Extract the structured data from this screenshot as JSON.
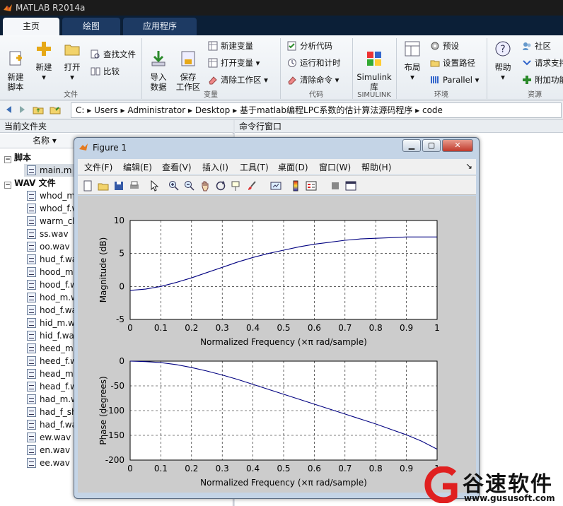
{
  "app": {
    "title": "MATLAB R2014a"
  },
  "tabs": [
    {
      "label": "主页"
    },
    {
      "label": "绘图"
    },
    {
      "label": "应用程序"
    }
  ],
  "ribbon": {
    "new_script": "新建\n脚本",
    "new": "新建",
    "open": "打开",
    "find_files": "查找文件",
    "compare": "比较",
    "import_data": "导入\n数据",
    "save_workspace": "保存\n工作区",
    "new_variable": "新建变量",
    "open_variable": "打开变量",
    "clear_workspace": "清除工作区",
    "analyze_code": "分析代码",
    "run_and_time": "运行和计时",
    "clear_commands": "清除命令",
    "simulink_library": "Simulink\n库",
    "layout": "布局",
    "preferences": "预设",
    "set_path": "设置路径",
    "parallel": "Parallel",
    "help": "帮助",
    "community": "社区",
    "request_support": "请求支持",
    "add_ons": "附加功能",
    "groups": {
      "file": "文件",
      "variable": "变量",
      "code": "代码",
      "simulink": "SIMULINK",
      "environment": "环境",
      "resources": "资源"
    }
  },
  "address": {
    "segments": [
      "C:",
      "Users",
      "Administrator",
      "Desktop",
      "基于matlab编程LPC系数的估计算法源码程序",
      "code"
    ]
  },
  "current_folder": {
    "title": "当前文件夹",
    "column_name": "名称",
    "sections": [
      {
        "label": "脚本",
        "files": [
          "main.m"
        ]
      },
      {
        "label": "WAV 文件",
        "files": [
          "whod_m.wav",
          "whod_f.wav",
          "warm_cl.wav",
          "ss.wav",
          "oo.wav",
          "hud_f.wav",
          "hood_m.wav",
          "hood_f.wav",
          "hod_m.wav",
          "hod_f.wav",
          "hid_m.wav",
          "hid_f.wav",
          "heed_m.wav",
          "heed_f.wav",
          "head_m.wav",
          "head_f.wav",
          "had_m.wav",
          "had_f_sh.wav",
          "had_f.wav",
          "ew.wav",
          "en.wav",
          "ee.wav"
        ]
      }
    ]
  },
  "command_window": {
    "title": "命令行窗口"
  },
  "figure": {
    "title": "Figure 1",
    "menu": [
      "文件(F)",
      "编辑(E)",
      "查看(V)",
      "插入(I)",
      "工具(T)",
      "桌面(D)",
      "窗口(W)",
      "帮助(H)"
    ],
    "toolbar_icons": [
      "new-figure-icon",
      "open-file-icon",
      "save-icon",
      "print-icon",
      "pointer-icon",
      "zoom-in-icon",
      "zoom-out-icon",
      "pan-icon",
      "rotate-icon",
      "data-cursor-icon",
      "brush-icon",
      "link-plot-icon",
      "colorbar-icon",
      "legend-icon",
      "hide-plot-tools-icon",
      "show-plot-tools-icon"
    ]
  },
  "chart_data": [
    {
      "type": "line",
      "title": "",
      "xlabel": "Normalized Frequency  (×π rad/sample)",
      "ylabel": "Magnitude (dB)",
      "xlim": [
        0,
        1
      ],
      "ylim": [
        -5,
        10
      ],
      "xticks": [
        "0",
        "0.1",
        "0.2",
        "0.3",
        "0.4",
        "0.5",
        "0.6",
        "0.7",
        "0.8",
        "0.9",
        "1"
      ],
      "yticks": [
        "-5",
        "0",
        "5",
        "10"
      ],
      "grid": true,
      "color": "#000080",
      "x": [
        0,
        0.05,
        0.1,
        0.15,
        0.2,
        0.25,
        0.3,
        0.35,
        0.4,
        0.45,
        0.5,
        0.55,
        0.6,
        0.65,
        0.7,
        0.75,
        0.8,
        0.85,
        0.9,
        0.95,
        1.0
      ],
      "y": [
        -0.6,
        -0.4,
        0.0,
        0.6,
        1.3,
        2.1,
        2.9,
        3.7,
        4.4,
        5.0,
        5.5,
        6.0,
        6.4,
        6.7,
        7.0,
        7.2,
        7.3,
        7.4,
        7.5,
        7.5,
        7.5
      ]
    },
    {
      "type": "line",
      "title": "",
      "xlabel": "Normalized Frequency  (×π rad/sample)",
      "ylabel": "Phase (degrees)",
      "xlim": [
        0,
        1
      ],
      "ylim": [
        -200,
        0
      ],
      "xticks": [
        "0",
        "0.1",
        "0.2",
        "0.3",
        "0.4",
        "0.5",
        "0.6",
        "0.7",
        "0.8",
        "0.9",
        "1"
      ],
      "yticks": [
        "-200",
        "-150",
        "-100",
        "-50",
        "0"
      ],
      "grid": true,
      "color": "#000080",
      "x": [
        0,
        0.05,
        0.1,
        0.15,
        0.2,
        0.25,
        0.3,
        0.35,
        0.4,
        0.45,
        0.5,
        0.55,
        0.6,
        0.65,
        0.7,
        0.75,
        0.8,
        0.85,
        0.9,
        0.95,
        1.0
      ],
      "y": [
        0,
        -1,
        -3,
        -7,
        -13,
        -20,
        -28,
        -37,
        -47,
        -57,
        -67,
        -77,
        -87,
        -97,
        -107,
        -117,
        -127,
        -138,
        -149,
        -162,
        -178
      ]
    }
  ],
  "watermark": {
    "brand": "谷速软件",
    "url": "www.gususoft.com"
  },
  "colors": {
    "accent": "#1d3a63",
    "plot_line": "#000080",
    "brand_red": "#e02020"
  }
}
